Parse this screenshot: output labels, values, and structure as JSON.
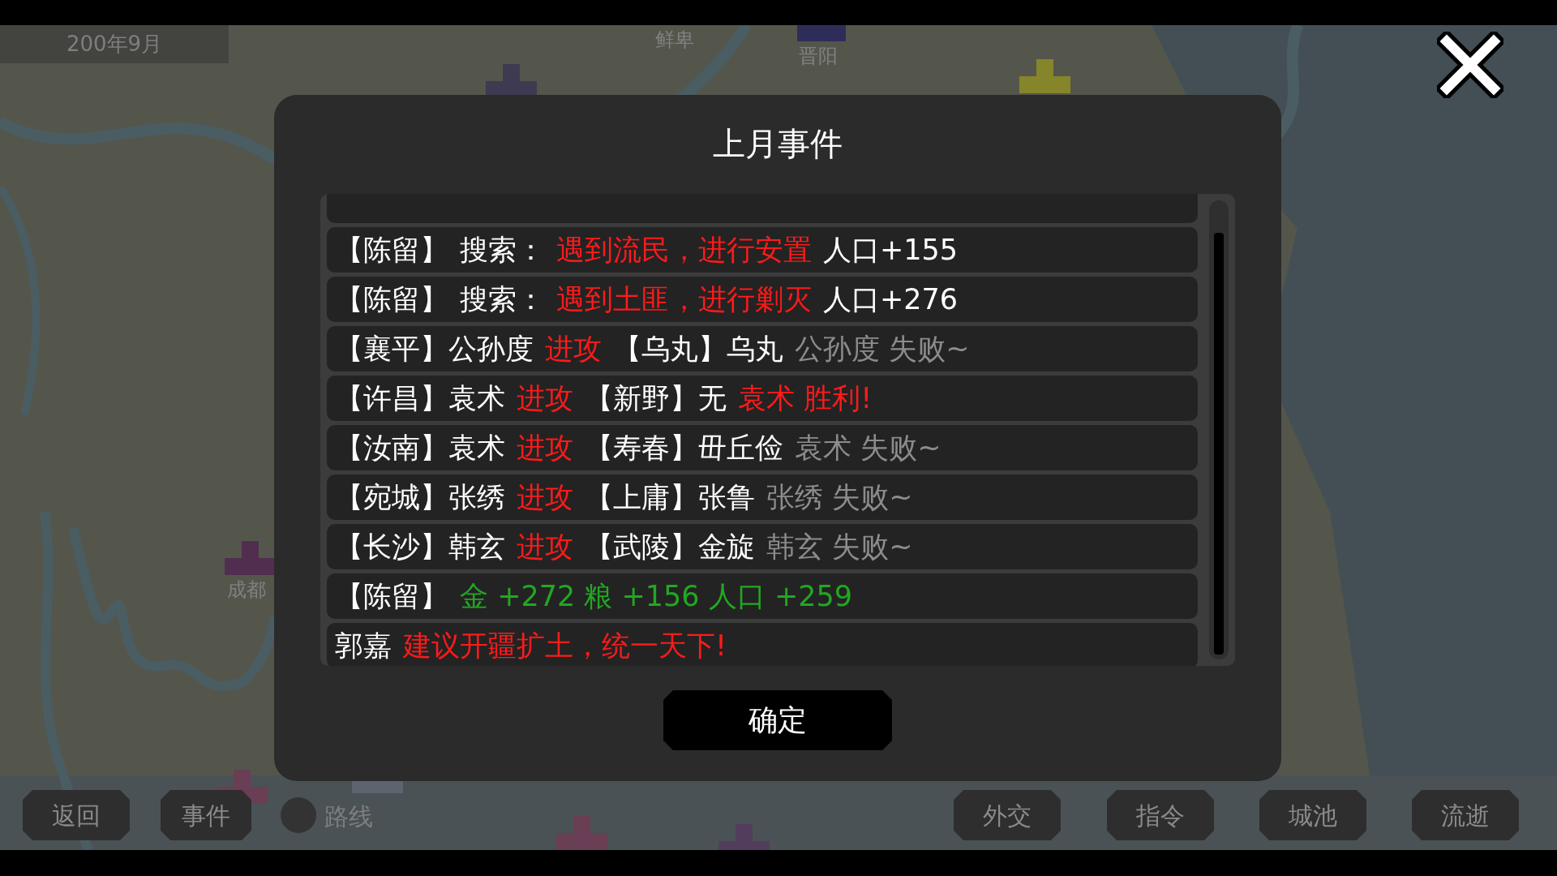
{
  "date": "200年9月",
  "map_labels": [
    "鲜卑",
    "晋阳",
    "成都"
  ],
  "dialog": {
    "title": "上月事件",
    "rows": [
      {
        "segments": [
          {
            "text": "【陈留】",
            "color": "#ffffff"
          },
          {
            "text": "搜索：",
            "color": "#ffffff"
          },
          {
            "text": "遇到流民，进行安置",
            "color": "#ff1a1a"
          },
          {
            "text": "人口+155",
            "color": "#ffffff"
          }
        ]
      },
      {
        "segments": [
          {
            "text": "【陈留】",
            "color": "#ffffff"
          },
          {
            "text": "搜索：",
            "color": "#ffffff"
          },
          {
            "text": "遇到土匪，进行剿灭",
            "color": "#ff1a1a"
          },
          {
            "text": "人口+276",
            "color": "#ffffff"
          }
        ]
      },
      {
        "segments": [
          {
            "text": "【襄平】公孙度",
            "color": "#ffffff"
          },
          {
            "text": "进攻",
            "color": "#ff1a1a"
          },
          {
            "text": "【乌丸】乌丸",
            "color": "#ffffff"
          },
          {
            "text": "公孙度 失败~",
            "color": "#8c8c8c"
          }
        ]
      },
      {
        "segments": [
          {
            "text": "【许昌】袁术",
            "color": "#ffffff"
          },
          {
            "text": "进攻",
            "color": "#ff1a1a"
          },
          {
            "text": "【新野】无",
            "color": "#ffffff"
          },
          {
            "text": "袁术 胜利!",
            "color": "#ff1a1a"
          }
        ]
      },
      {
        "segments": [
          {
            "text": "【汝南】袁术",
            "color": "#ffffff"
          },
          {
            "text": "进攻",
            "color": "#ff1a1a"
          },
          {
            "text": "【寿春】毌丘俭",
            "color": "#ffffff"
          },
          {
            "text": "袁术 失败~",
            "color": "#8c8c8c"
          }
        ]
      },
      {
        "segments": [
          {
            "text": "【宛城】张绣",
            "color": "#ffffff"
          },
          {
            "text": "进攻",
            "color": "#ff1a1a"
          },
          {
            "text": "【上庸】张鲁",
            "color": "#ffffff"
          },
          {
            "text": "张绣 失败~",
            "color": "#8c8c8c"
          }
        ]
      },
      {
        "segments": [
          {
            "text": "【长沙】韩玄",
            "color": "#ffffff"
          },
          {
            "text": "进攻",
            "color": "#ff1a1a"
          },
          {
            "text": "【武陵】金旋",
            "color": "#ffffff"
          },
          {
            "text": "韩玄 失败~",
            "color": "#8c8c8c"
          }
        ]
      },
      {
        "segments": [
          {
            "text": "【陈留】",
            "color": "#ffffff"
          },
          {
            "text": "金 +272 粮 +156  人口 +259",
            "color": "#22a722"
          }
        ]
      },
      {
        "segments": [
          {
            "text": "郭嘉",
            "color": "#ffffff"
          },
          {
            "text": "建议开疆扩土，统一天下!",
            "color": "#ff1a1a"
          }
        ]
      }
    ],
    "confirm": "确定"
  },
  "left_buttons": [
    "返回",
    "事件"
  ],
  "route_toggle": {
    "label": "路线",
    "on": false
  },
  "right_buttons": [
    "外交",
    "指令",
    "城池",
    "流逝"
  ]
}
